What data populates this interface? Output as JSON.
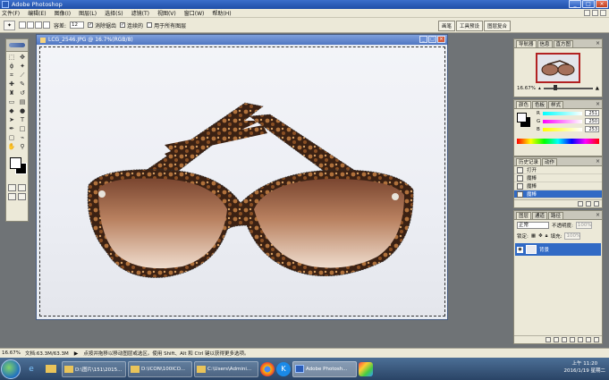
{
  "app": {
    "title": "Adobe Photoshop",
    "window_buttons": [
      "_",
      "□",
      "×"
    ]
  },
  "menu": [
    "文件(F)",
    "编辑(E)",
    "图像(I)",
    "图层(L)",
    "选择(S)",
    "滤镜(T)",
    "视图(V)",
    "窗口(W)",
    "帮助(H)"
  ],
  "options": {
    "tolerance_label": "容差:",
    "tolerance_value": "12",
    "antialias_label": "消除锯齿",
    "contiguous_label": "连续的",
    "all_layers_label": "用于所有图层"
  },
  "wells": [
    "画笔",
    "工具预设",
    "图层复合"
  ],
  "document": {
    "title": "LCG_2546.JPG @ 16.7%(RGB/8)"
  },
  "navigator": {
    "tabs": [
      "导航器",
      "信息",
      "直方图"
    ],
    "zoom": "16.67%"
  },
  "color": {
    "tabs": [
      "颜色",
      "色板",
      "样式"
    ],
    "r_label": "R",
    "g_label": "G",
    "b_label": "B",
    "r": "251",
    "g": "250",
    "b": "253"
  },
  "history": {
    "tabs": [
      "历史记录",
      "动作"
    ],
    "items": [
      "打开",
      "魔棒",
      "魔棒",
      "魔棒"
    ]
  },
  "layers": {
    "tabs": [
      "图层",
      "通道",
      "路径"
    ],
    "blend": "正常",
    "opacity_label": "不透明度:",
    "opacity": "100%",
    "lock_label": "锁定:",
    "fill_label": "填充:",
    "fill": "100%",
    "layer_name": "背景"
  },
  "status": {
    "zoom": "16.67%",
    "doc": "文档:63.3M/63.3M",
    "hint": "点按并拖移以移动图层或选区。使用 Shift、Alt 和 Ctrl 键以获得更多选项。"
  },
  "taskbar": {
    "buttons": [
      "D:\\图片\\151\\2015...",
      "D:\\ICON\\100ICO...",
      "C:\\Users\\Admini...",
      "Adobe Photosh..."
    ],
    "time": "上午 11:20",
    "date": "2016/1/19 星期二"
  },
  "colors": {
    "accent": "#316ac5",
    "title_blue": "#1f4ea6",
    "workspace": "#6f7376"
  }
}
